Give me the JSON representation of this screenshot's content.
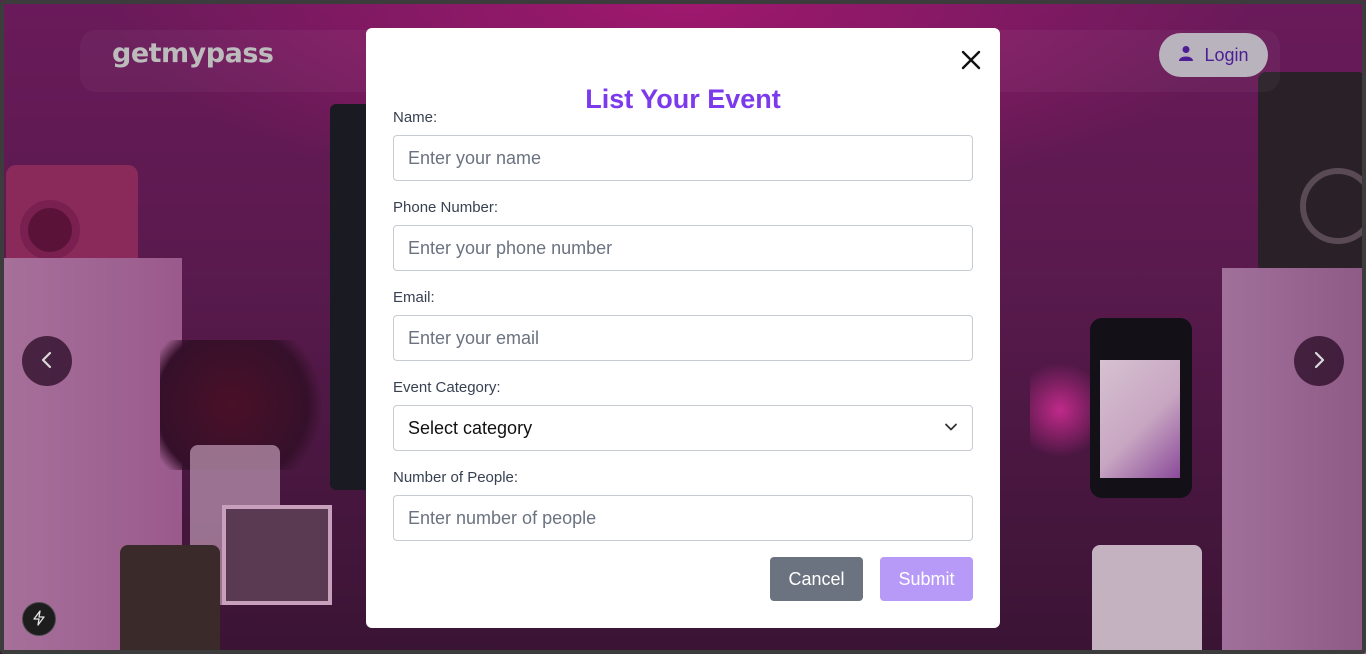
{
  "header": {
    "logo": "getmypass",
    "login_label": "Login"
  },
  "modal": {
    "title": "List Your Event",
    "fields": {
      "name": {
        "label": "Name:",
        "placeholder": "Enter your name"
      },
      "phone": {
        "label": "Phone Number:",
        "placeholder": "Enter your phone number"
      },
      "email": {
        "label": "Email:",
        "placeholder": "Enter your email"
      },
      "category": {
        "label": "Event Category:",
        "selected": "Select category"
      },
      "people": {
        "label": "Number of People:",
        "placeholder": "Enter number of people"
      }
    },
    "cancel_label": "Cancel",
    "submit_label": "Submit"
  },
  "colors": {
    "accent": "#7c3aed",
    "submit_bg": "#b79af7",
    "cancel_bg": "#6b7280"
  },
  "icons": [
    "user-icon",
    "chevron-left-icon",
    "chevron-right-icon",
    "close-icon",
    "chevron-down-icon",
    "bolt-icon"
  ]
}
